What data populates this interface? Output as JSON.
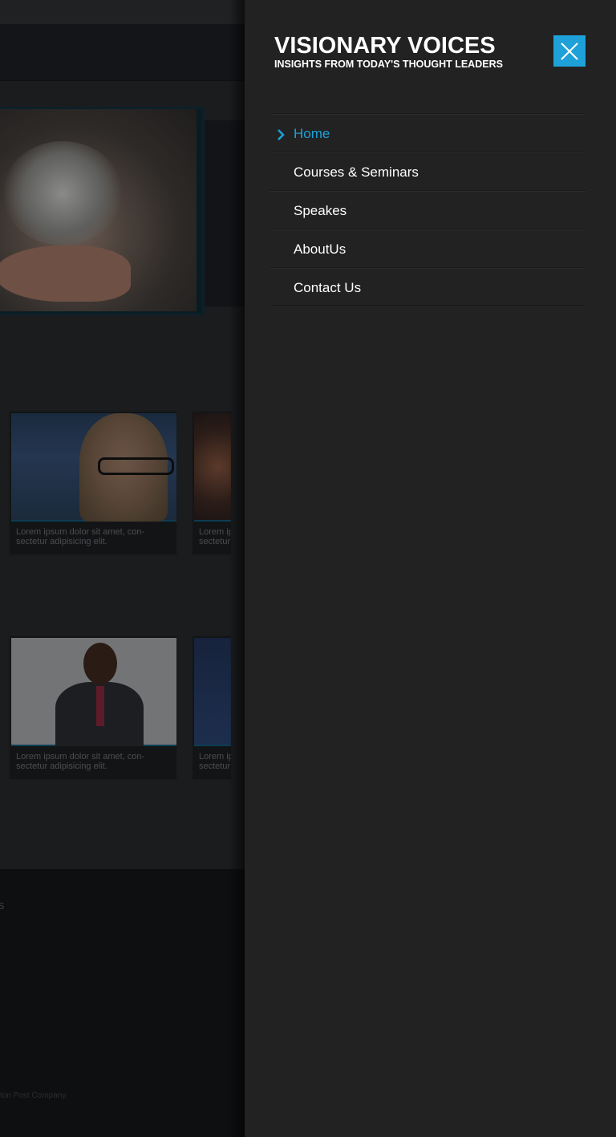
{
  "brand": {
    "title": "VISIONARY VOICES",
    "tagline": "INSIGHTS FROM TODAY'S THOUGHT LEADERS"
  },
  "menu": {
    "close_icon": "close-icon",
    "active_color": "#1da1d8",
    "items": [
      {
        "label": "Home",
        "active": true
      },
      {
        "label": "Courses & Seminars",
        "active": false
      },
      {
        "label": "Speakes",
        "active": false
      },
      {
        "label": "AboutUs",
        "active": false
      },
      {
        "label": "Contact Us",
        "active": false
      }
    ]
  },
  "background_page": {
    "cards": [
      {
        "caption": "Lorem ipsum dolor sit amet, con-\nsectetur adipisicing elit."
      },
      {
        "caption": "Lorem ipsum dolor sit amet, con-\nsectetur adipisicing elit."
      },
      {
        "caption": "Lorem ipsum dolor sit amet, con-\nsectetur adipisicing elit."
      },
      {
        "caption": "Lorem ipsum dolor sit amet, con-\nsectetur adipisicing elit."
      }
    ],
    "footer_fragment": "s",
    "footer_copyright": "ton Post Company."
  }
}
